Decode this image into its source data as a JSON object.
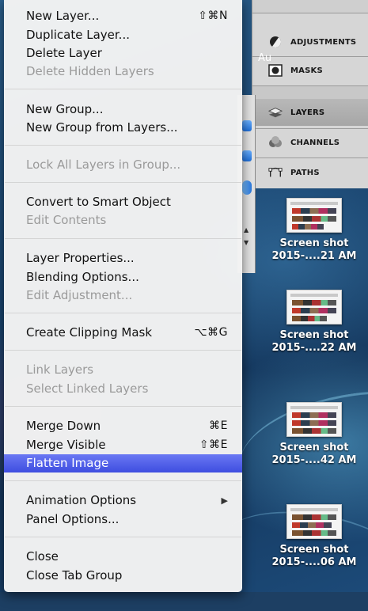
{
  "desktop": {
    "overlap_text": "Au",
    "items": [
      {
        "label_line1": "Screen shot",
        "label_line2": "2015-....21 AM"
      },
      {
        "label_line1": "Screen shot",
        "label_line2": "2015-....22 AM"
      },
      {
        "label_line1": "Screen shot",
        "label_line2": "2015-....42 AM"
      },
      {
        "label_line1": "Screen shot",
        "label_line2": "2015-....06 AM"
      }
    ]
  },
  "panel_dock": {
    "items": [
      {
        "label": "ADJUSTMENTS",
        "icon": "adjustments-icon"
      },
      {
        "label": "MASKS",
        "icon": "masks-icon"
      },
      {
        "label": "LAYERS",
        "icon": "layers-icon",
        "active": true
      },
      {
        "label": "CHANNELS",
        "icon": "channels-icon"
      },
      {
        "label": "PATHS",
        "icon": "paths-icon"
      }
    ]
  },
  "menu": {
    "items": [
      {
        "label": "New Layer...",
        "shortcut": "⇧⌘N",
        "enabled": true
      },
      {
        "label": "Duplicate Layer...",
        "enabled": true
      },
      {
        "label": "Delete Layer",
        "enabled": true
      },
      {
        "label": "Delete Hidden Layers",
        "enabled": false
      },
      {
        "label": "New Group...",
        "enabled": true
      },
      {
        "label": "New Group from Layers...",
        "enabled": true
      },
      {
        "label": "Lock All Layers in Group...",
        "enabled": false
      },
      {
        "label": "Convert to Smart Object",
        "enabled": true
      },
      {
        "label": "Edit Contents",
        "enabled": false
      },
      {
        "label": "Layer Properties...",
        "enabled": true
      },
      {
        "label": "Blending Options...",
        "enabled": true
      },
      {
        "label": "Edit Adjustment...",
        "enabled": false
      },
      {
        "label": "Create Clipping Mask",
        "shortcut": "⌥⌘G",
        "enabled": true
      },
      {
        "label": "Link Layers",
        "enabled": false
      },
      {
        "label": "Select Linked Layers",
        "enabled": false
      },
      {
        "label": "Merge Down",
        "shortcut": "⌘E",
        "enabled": true
      },
      {
        "label": "Merge Visible",
        "shortcut": "⇧⌘E",
        "enabled": true
      },
      {
        "label": "Flatten Image",
        "enabled": true,
        "highlighted": true
      },
      {
        "label": "Animation Options",
        "enabled": true,
        "submenu": true
      },
      {
        "label": "Panel Options...",
        "enabled": true
      },
      {
        "label": "Close",
        "enabled": true
      },
      {
        "label": "Close Tab Group",
        "enabled": true
      }
    ]
  },
  "colors": {
    "highlight": "#4a59e8",
    "disabled_text": "#9a9a9a"
  }
}
